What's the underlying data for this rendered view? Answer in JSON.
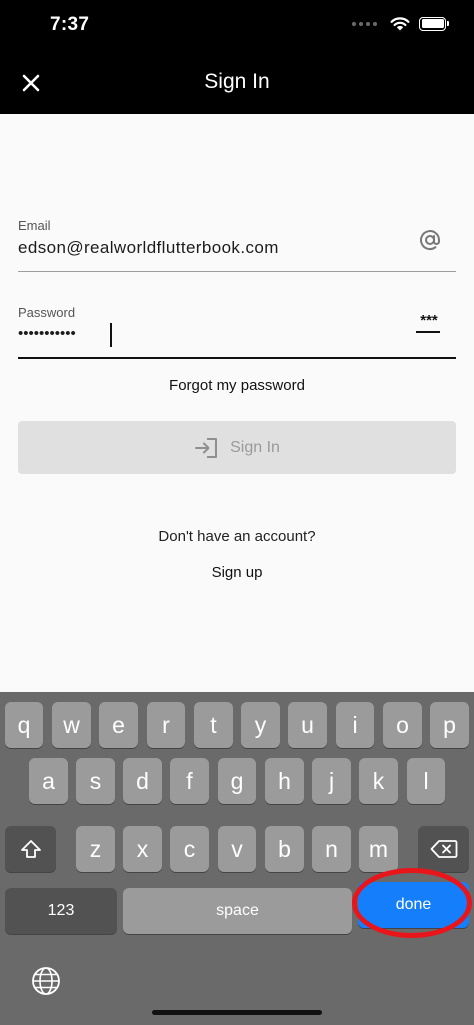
{
  "status_bar": {
    "time": "7:37"
  },
  "app_bar": {
    "title": "Sign In"
  },
  "form": {
    "email": {
      "label": "Email",
      "value": "edson@realworldflutterbook.com"
    },
    "password": {
      "label": "Password",
      "value": "•••••••••••",
      "suffix": "***"
    },
    "forgot_password": "Forgot my password",
    "sign_in_button": "Sign In",
    "no_account": "Don't have an account?",
    "sign_up": "Sign up"
  },
  "keyboard": {
    "row1": [
      "q",
      "w",
      "e",
      "r",
      "t",
      "y",
      "u",
      "i",
      "o",
      "p"
    ],
    "row2": [
      "a",
      "s",
      "d",
      "f",
      "g",
      "h",
      "j",
      "k",
      "l"
    ],
    "row3": [
      "z",
      "x",
      "c",
      "v",
      "b",
      "n",
      "m"
    ],
    "numbers_key": "123",
    "space_key": "space",
    "done_key": "done"
  },
  "colors": {
    "app_bar": "#000000",
    "done_key": "#147efb",
    "highlight": "#e8161a"
  }
}
